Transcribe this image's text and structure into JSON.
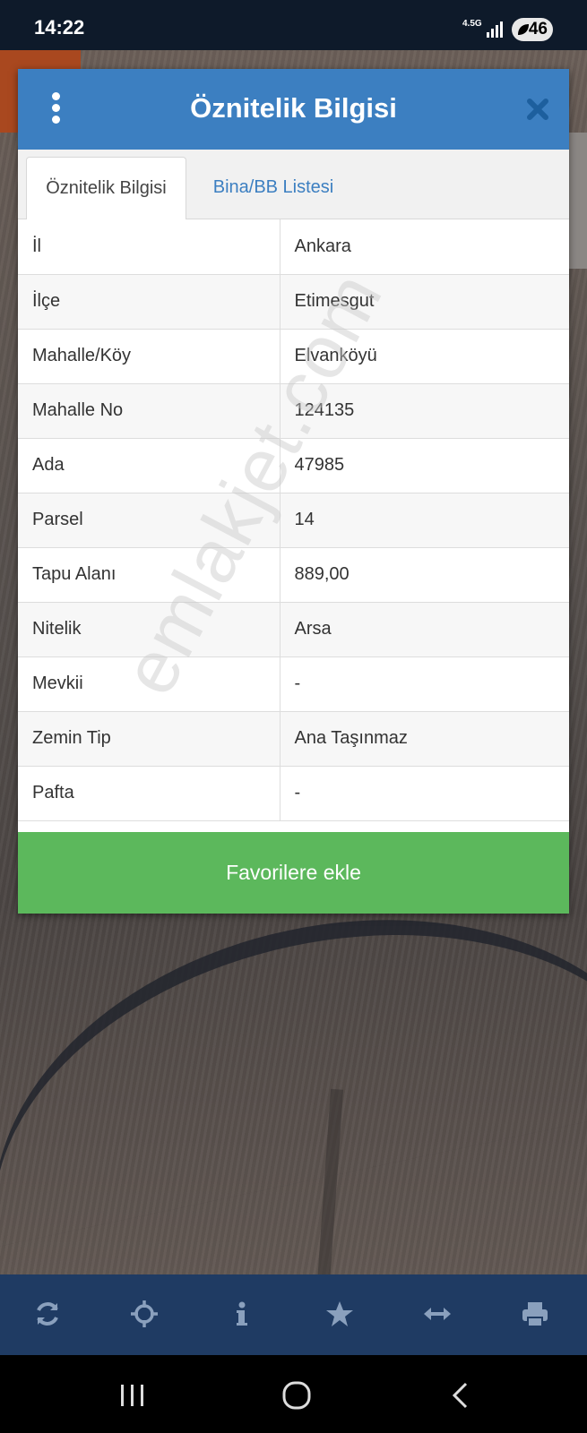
{
  "status_bar": {
    "time": "14:22",
    "network": "4.5G",
    "battery": "46"
  },
  "modal": {
    "title": "Öznitelik Bilgisi",
    "tabs": [
      {
        "label": "Öznitelik Bilgisi",
        "active": true
      },
      {
        "label": "Bina/BB Listesi",
        "active": false
      }
    ],
    "rows": [
      {
        "key": "İl",
        "value": "Ankara"
      },
      {
        "key": "İlçe",
        "value": "Etimesgut"
      },
      {
        "key": "Mahalle/Köy",
        "value": "Elvanköyü"
      },
      {
        "key": "Mahalle No",
        "value": "124135"
      },
      {
        "key": "Ada",
        "value": "47985"
      },
      {
        "key": "Parsel",
        "value": "14"
      },
      {
        "key": "Tapu Alanı",
        "value": "889,00"
      },
      {
        "key": "Nitelik",
        "value": "Arsa"
      },
      {
        "key": "Mevkii",
        "value": "-"
      },
      {
        "key": "Zemin Tip",
        "value": "Ana Taşınmaz"
      },
      {
        "key": "Pafta",
        "value": "-"
      }
    ],
    "favorite_button": "Favorilere ekle"
  },
  "watermark": "emlakjet.com",
  "toolbar": {
    "icons": [
      "refresh-icon",
      "crosshair-icon",
      "info-icon",
      "star-icon",
      "measure-icon",
      "print-icon"
    ]
  },
  "colors": {
    "header": "#3c7fc1",
    "button": "#5cb85c",
    "toolbar": "#1f3b63",
    "status_bar": "#0e1a2a"
  }
}
